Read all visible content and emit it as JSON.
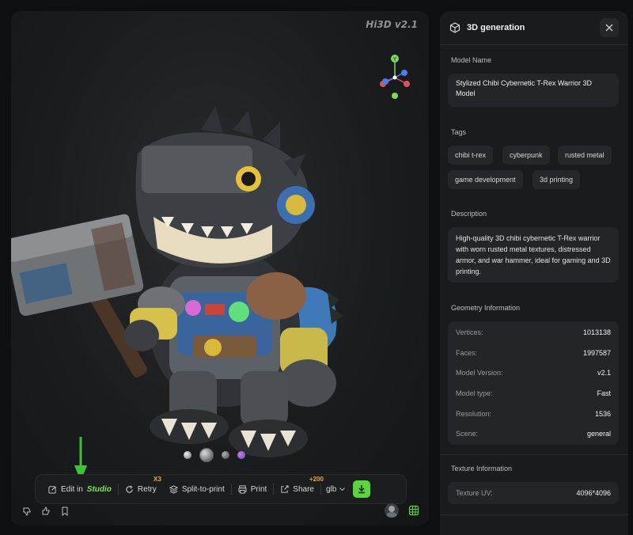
{
  "viewer": {
    "version_label": "Hi3D v2.1",
    "gizmo_axis_label": "Y"
  },
  "toolbar": {
    "edit_label": "Edit in",
    "edit_studio": "Studio",
    "retry_label": "Retry",
    "retry_badge": "X3",
    "split_label": "Split-to-print",
    "print_label": "Print",
    "share_label": "Share",
    "share_badge": "+200",
    "format_value": "glb",
    "accent_color": "#58d63a"
  },
  "panel": {
    "title": "3D generation",
    "model_name_label": "Model Name",
    "model_name": "Stylized Chibi Cybernetic T-Rex Warrior 3D Model",
    "tags_label": "Tags",
    "tags": [
      "chibi t-rex",
      "cyberpunk",
      "rusted metal",
      "game development",
      "3d printing"
    ],
    "description_label": "Description",
    "description": "High-quality 3D chibi cybernetic T-Rex warrior with worn rusted metal textures, distressed armor, and war hammer, ideal for gaming and 3D printing.",
    "geometry_label": "Geometry Information",
    "geometry": [
      {
        "key": "Vertices:",
        "value": "1013138"
      },
      {
        "key": "Faces:",
        "value": "1997587"
      },
      {
        "key": "Model Version:",
        "value": "v2.1"
      },
      {
        "key": "Model type:",
        "value": "Fast"
      },
      {
        "key": "Resolution:",
        "value": "1536"
      },
      {
        "key": "Scene:",
        "value": "general"
      }
    ],
    "texture_label": "Texture Information",
    "texture": [
      {
        "key": "Texture UV:",
        "value": "4096*4096"
      }
    ]
  }
}
